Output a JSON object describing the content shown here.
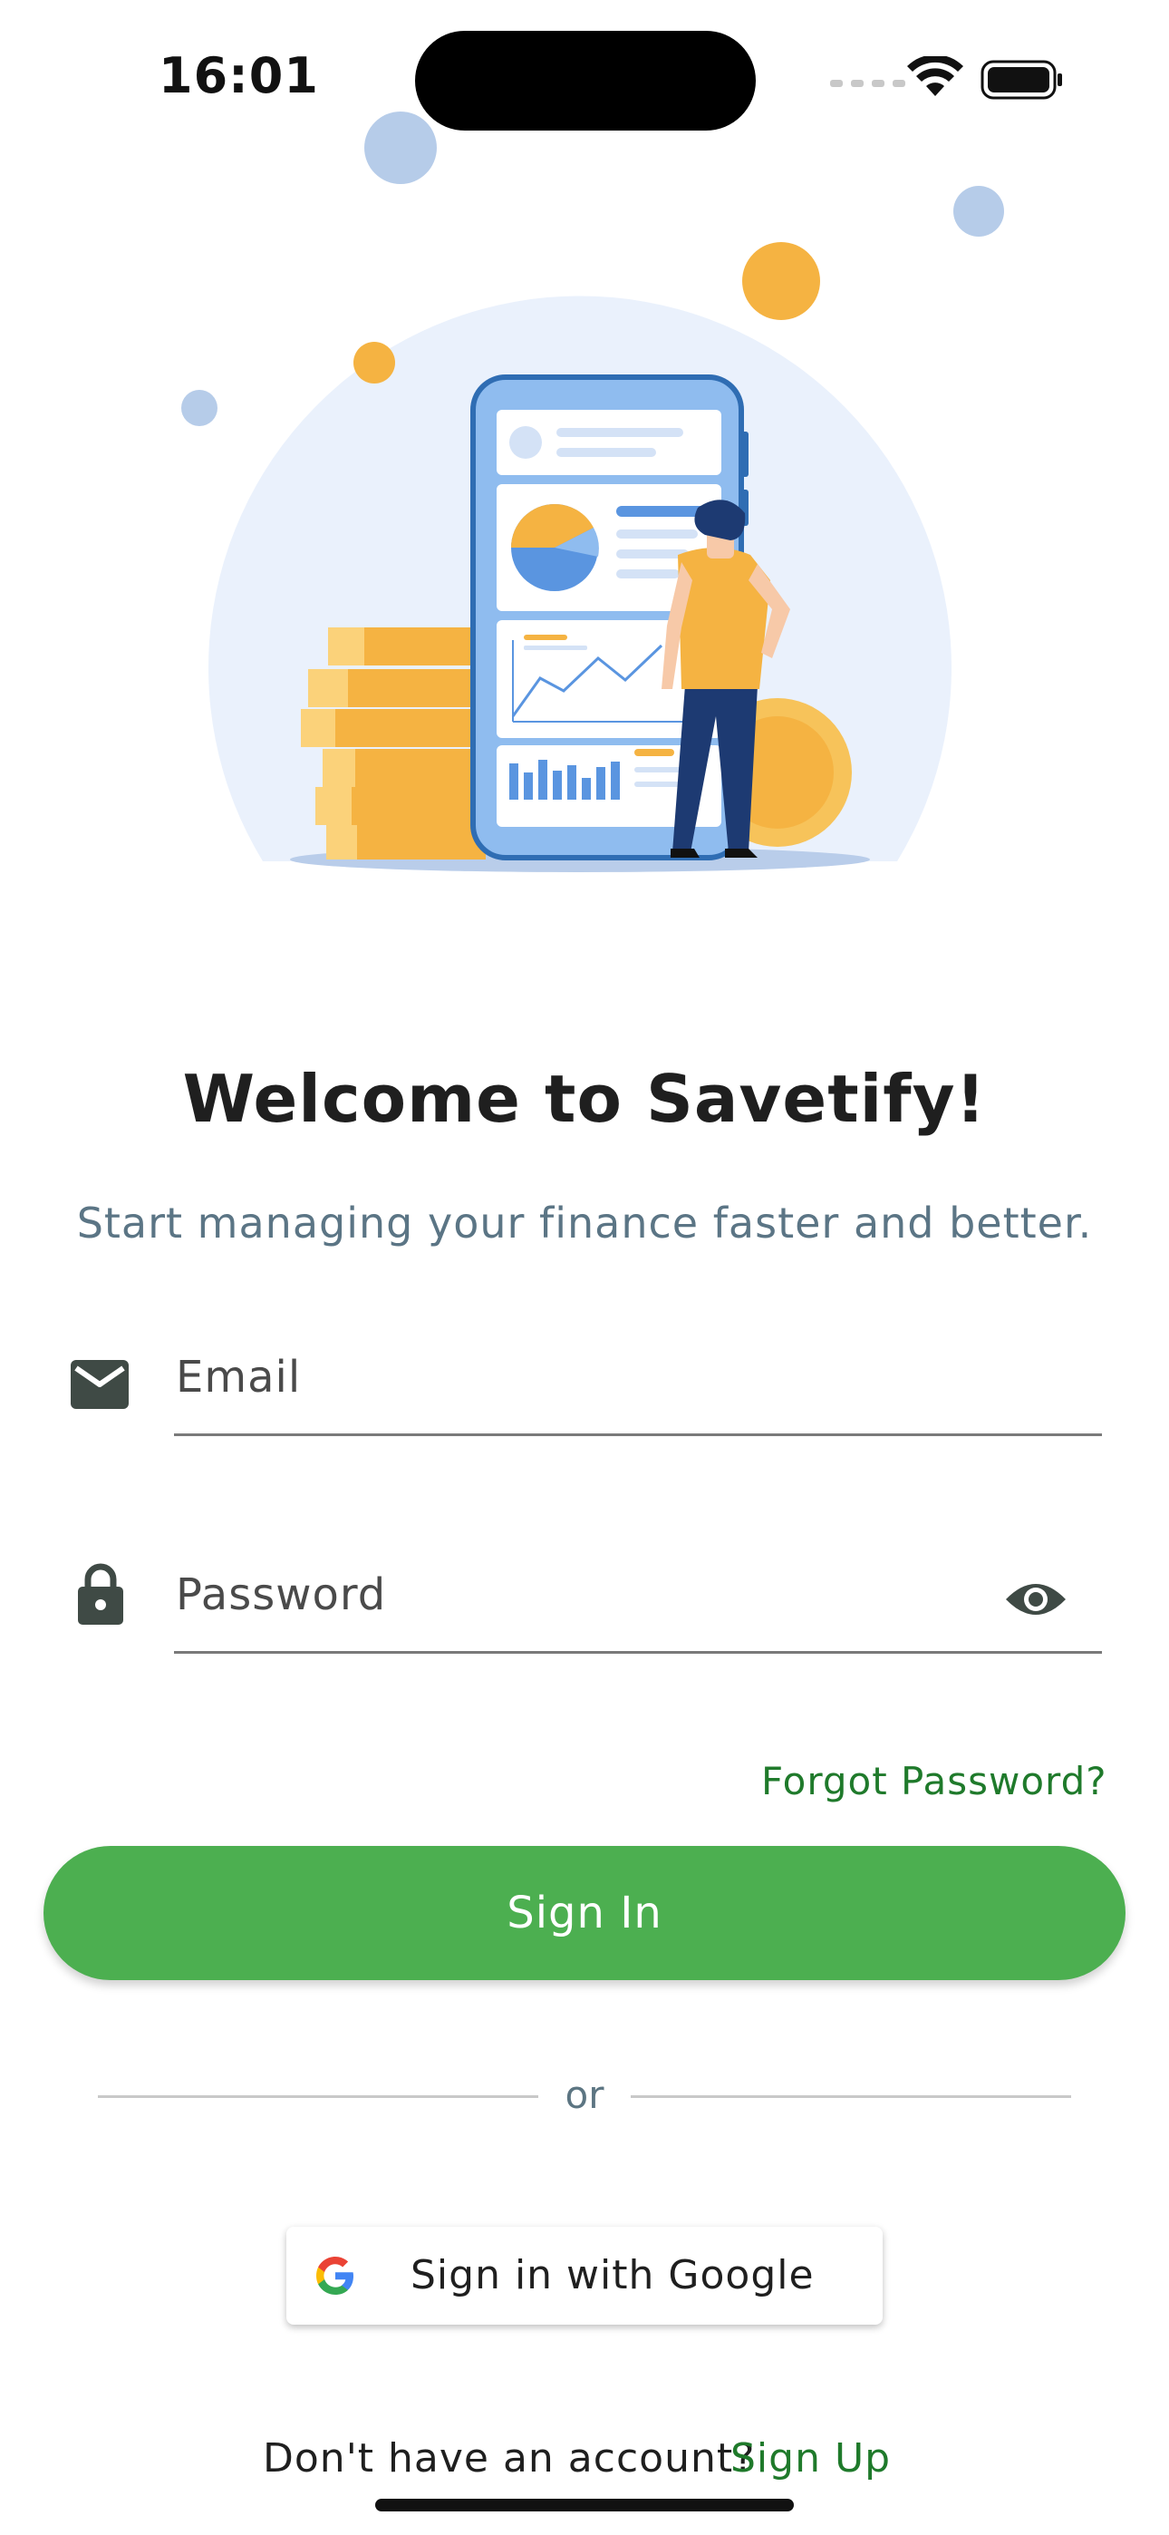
{
  "status_bar": {
    "time": "16:01",
    "icons": [
      "cellular-signal-icon",
      "wifi-icon",
      "battery-icon"
    ]
  },
  "illustration": {
    "description_icon": "finance-app-illustration"
  },
  "header": {
    "title": "Welcome to Savetify!",
    "subtitle": "Start managing your finance faster and better."
  },
  "form": {
    "email": {
      "placeholder": "Email",
      "value": "",
      "icon": "mail-icon"
    },
    "password": {
      "placeholder": "Password",
      "value": "",
      "icon": "lock-icon",
      "toggle_icon": "eye-icon"
    },
    "forgot_label": "Forgot Password?",
    "signin_label": "Sign In",
    "divider_label": "or",
    "google_label": "Sign in with Google"
  },
  "footer": {
    "prompt": "Don't have an account?",
    "signup_label": "Sign Up"
  },
  "colors": {
    "primary": "#4caf50",
    "link": "#1f7a2b",
    "subtitle": "#5b7585",
    "illustration_blue": "#8fbcef",
    "illustration_orange": "#f5b342"
  }
}
